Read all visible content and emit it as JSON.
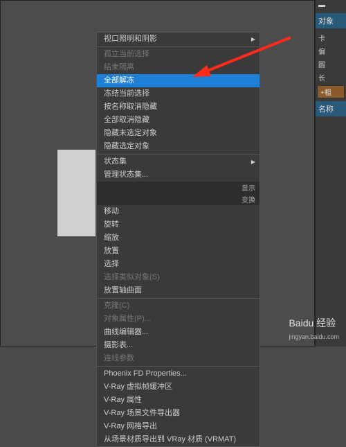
{
  "menu": {
    "group1": [
      {
        "label": "视口照明和阴影",
        "arrow": true
      }
    ],
    "group2": [
      {
        "label": "孤立当前选择",
        "disabled": true
      },
      {
        "label": "结束隔离",
        "disabled": true
      },
      {
        "label": "全部解冻",
        "highlighted": true
      },
      {
        "label": "冻结当前选择"
      },
      {
        "label": "按名称取消隐藏"
      },
      {
        "label": "全部取消隐藏"
      },
      {
        "label": "隐藏未选定对象"
      },
      {
        "label": "隐藏选定对象"
      }
    ],
    "group3_label": "",
    "group3": [
      {
        "label": "状态集",
        "arrow": true
      },
      {
        "label": "管理状态集..."
      }
    ],
    "group_display": "显示",
    "group_transform": "变换",
    "group4": [
      {
        "label": "移动"
      },
      {
        "label": "旋转"
      },
      {
        "label": "缩放"
      },
      {
        "label": "放置"
      },
      {
        "label": "选择"
      },
      {
        "label": "选择类似对象(S)",
        "disabled": true
      },
      {
        "label": "放置轴曲面"
      }
    ],
    "group5": [
      {
        "label": "克隆(C)",
        "disabled": true
      },
      {
        "label": "对象属性(P)...",
        "disabled": true
      },
      {
        "label": "曲线编辑器..."
      },
      {
        "label": "摄影表..."
      },
      {
        "label": "连线参数",
        "disabled": true
      }
    ],
    "group6": [
      {
        "label": "Phoenix FD Properties..."
      },
      {
        "label": "V-Ray 虚拟帧缓冲区"
      },
      {
        "label": "V-Ray 属性"
      },
      {
        "label": "V-Ray 场景文件导出器"
      },
      {
        "label": "V-Ray 网格导出"
      },
      {
        "label": "从场景材质导出到 VRay 材质 (VRMAT)"
      }
    ]
  },
  "panel": {
    "header1": "对象",
    "rows": [
      "卡",
      "偏",
      "圆",
      "长"
    ],
    "button": "+粗",
    "header2": "名称"
  },
  "watermark": {
    "main": "Baidu 经验",
    "sub": "jingyan.baidu.com"
  },
  "colors": {
    "highlight": "#1e7fd6",
    "arrow": "#ff2a1a"
  }
}
